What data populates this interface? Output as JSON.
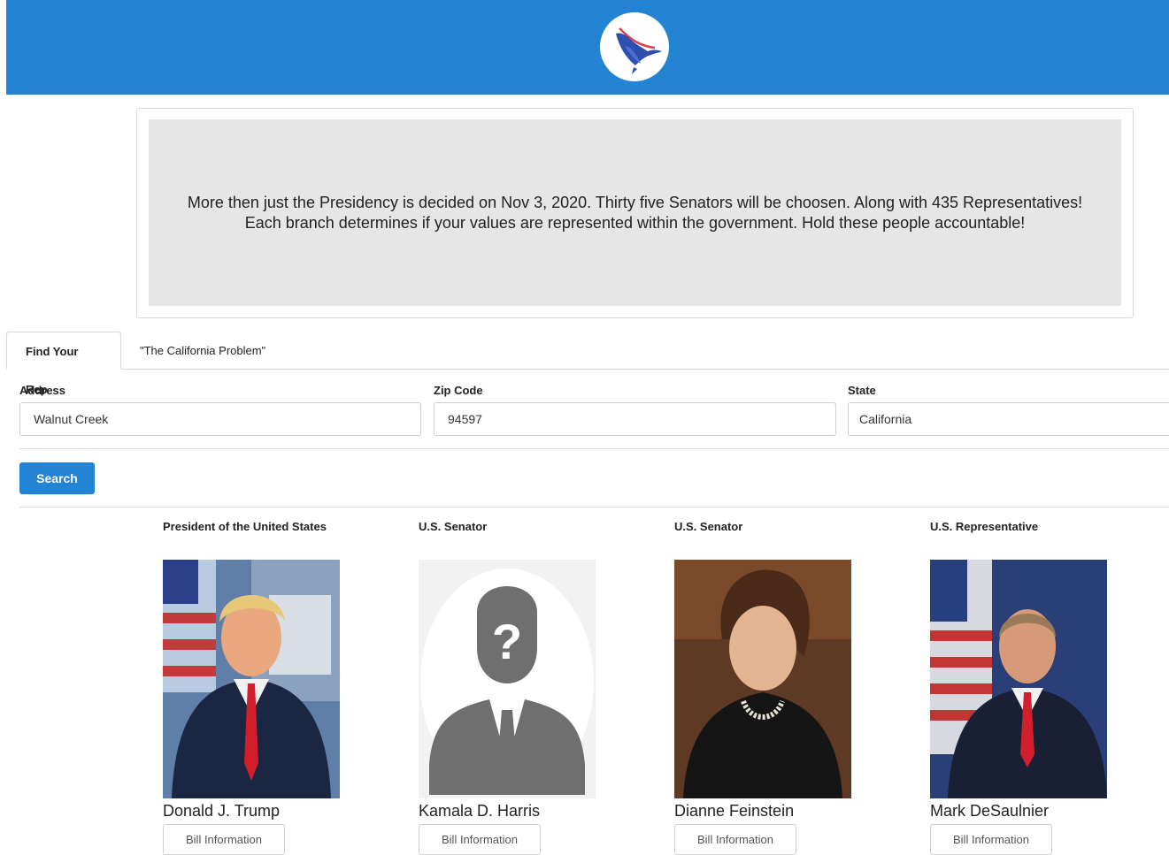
{
  "header": {
    "logo_icon": "eagle-logo-icon",
    "brand_color": "#2484d4"
  },
  "banner": {
    "line1": "More then just the Presidency is decided on Nov 3, 2020. Thirty five Senators will be choosen. Along with 435 Representatives!",
    "line2": "Each branch determines if your values are represented within the government. Hold these people accountable!"
  },
  "tabs": [
    {
      "label": "Find Your Rep",
      "active": true
    },
    {
      "label": "\"The California Problem\"",
      "active": false
    }
  ],
  "form": {
    "address": {
      "label": "Address",
      "value": "Walnut Creek"
    },
    "zip": {
      "label": "Zip Code",
      "value": "94597"
    },
    "state": {
      "label": "State",
      "value": "California"
    },
    "search_label": "Search"
  },
  "reps": [
    {
      "role": "President of the United States",
      "name": "Donald J. Trump",
      "button": "Bill Information"
    },
    {
      "role": "U.S. Senator",
      "name": "Kamala D. Harris",
      "button": "Bill Information"
    },
    {
      "role": "U.S. Senator",
      "name": "Dianne Feinstein",
      "button": "Bill Information"
    },
    {
      "role": "U.S. Representative",
      "name": "Mark DeSaulnier",
      "button": "Bill Information"
    }
  ]
}
